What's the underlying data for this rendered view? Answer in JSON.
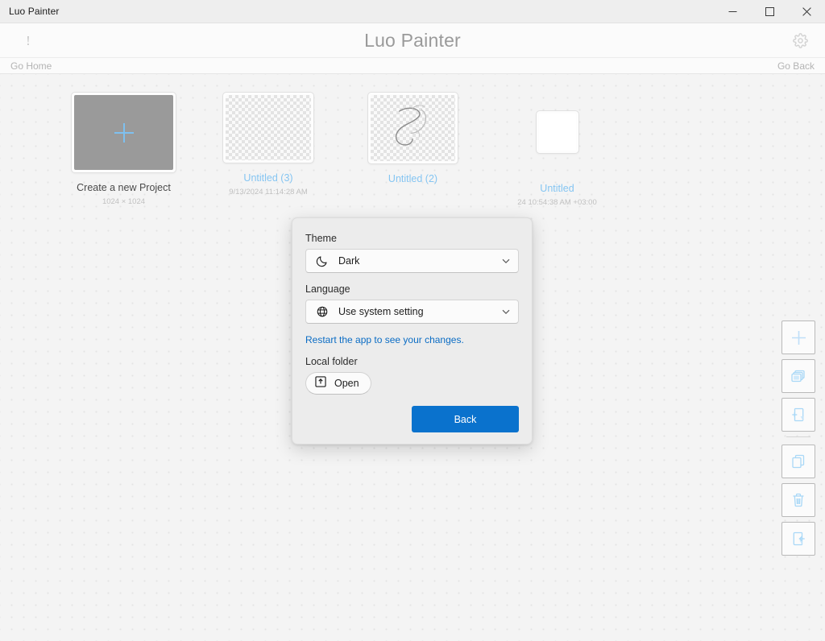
{
  "window": {
    "title": "Luo Painter",
    "controls": {
      "minimize": "minimize-button",
      "maximize": "maximize-button",
      "close": "close-button"
    }
  },
  "header": {
    "title": "Luo Painter",
    "info_glyph": "!",
    "settings_icon": "gear-icon"
  },
  "nav": {
    "go_home": "Go Home",
    "go_back": "Go Back"
  },
  "projects": [
    {
      "label": "Create a new Project",
      "sub": "1024 × 1024",
      "kind": "new",
      "label_color": "#4a4a4a"
    },
    {
      "label": "Untitled (3)",
      "sub": "9/13/2024 11:14:28 AM",
      "kind": "empty",
      "label_color": "#85c5f2"
    },
    {
      "label": "Untitled (2)",
      "sub": "",
      "kind": "sketch",
      "label_color": "#85c5f2"
    },
    {
      "label": "Untitled",
      "sub": "24 10:54:38 AM +03:00",
      "kind": "white",
      "label_color": "#85c5f2"
    }
  ],
  "toolrail": [
    {
      "name": "add-button",
      "icon": "plus-icon"
    },
    {
      "name": "layers-button",
      "icon": "layers-icon"
    },
    {
      "name": "new-page-button",
      "icon": "add-page-icon"
    },
    {
      "name": "duplicate-button",
      "icon": "copy-icon"
    },
    {
      "name": "delete-button",
      "icon": "trash-icon"
    },
    {
      "name": "import-button",
      "icon": "import-icon"
    }
  ],
  "settings": {
    "theme_label": "Theme",
    "theme_value": "Dark",
    "theme_icon": "moon-icon",
    "language_label": "Language",
    "language_value": "Use system setting",
    "language_icon": "globe-icon",
    "restart_note": "Restart the app to see your changes.",
    "local_folder_label": "Local folder",
    "open_label": "Open",
    "open_icon": "open-folder-icon",
    "back_label": "Back"
  },
  "colors": {
    "accent": "#0a72cd",
    "link": "#0a6cc4",
    "project_label": "#85c5f2",
    "icon_blue": "#a9d8f7"
  }
}
